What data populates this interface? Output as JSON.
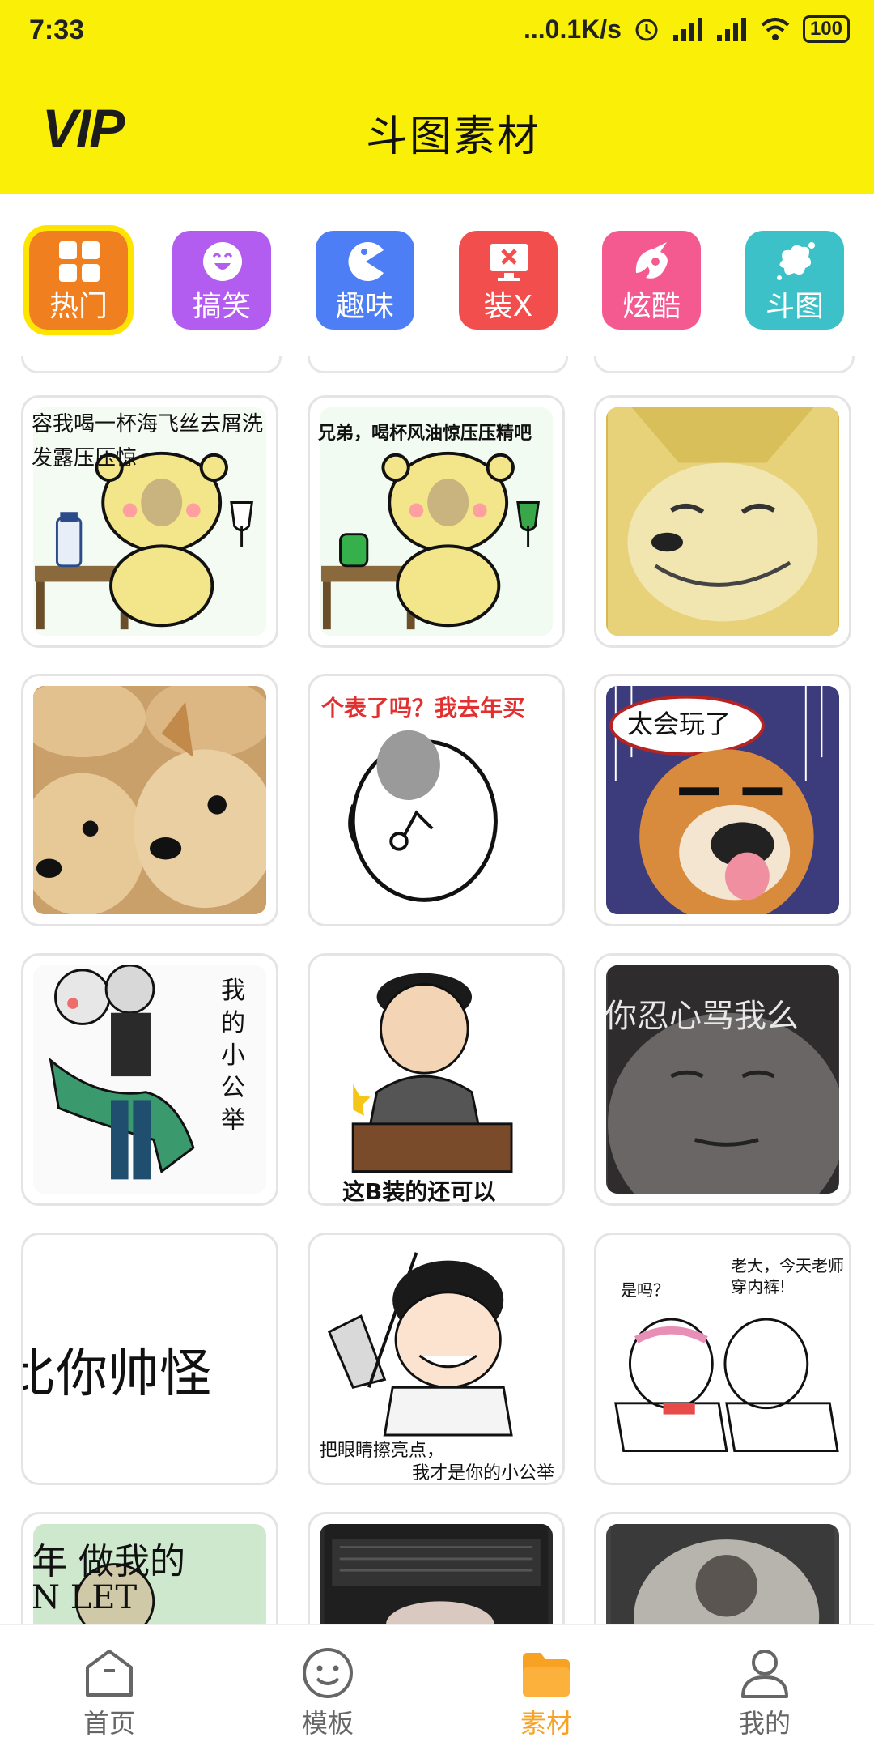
{
  "status": {
    "time": "7:33",
    "network": "...0.1K/s",
    "battery": "100"
  },
  "header": {
    "vip_logo": "VIP",
    "title": "斗图素材"
  },
  "categories": [
    {
      "label": "热门",
      "icon": "grid-icon",
      "color": "#f07f1f",
      "active": true
    },
    {
      "label": "搞笑",
      "icon": "laugh-icon",
      "color": "#b35cf0"
    },
    {
      "label": "趣味",
      "icon": "pacman-icon",
      "color": "#4d7ef5"
    },
    {
      "label": "装X",
      "icon": "screen-x-icon",
      "color": "#f24e4e"
    },
    {
      "label": "炫酷",
      "icon": "flame-icon",
      "color": "#f45a8f"
    },
    {
      "label": "斗图",
      "icon": "splash-icon",
      "color": "#3cc1c8"
    }
  ],
  "memes": [
    {
      "caption": "容我喝一杯海飞丝去屑洗发露压压惊",
      "line1": "容我喝一杯海飞丝去屑洗",
      "line2": "发露压压惊"
    },
    {
      "caption": "兄弟，喝杯风油惊压压精吧",
      "line1": "兄弟，喝杯风油惊压压精吧"
    },
    {
      "caption": ""
    },
    {
      "caption": ""
    },
    {
      "caption": "个表了吗？我去年买",
      "line1": "个表了吗？我去年买"
    },
    {
      "caption": "太会玩了",
      "line1": "太会玩了"
    },
    {
      "caption": "我的小公举",
      "vertical": [
        "我",
        "的",
        "小",
        "公",
        "举"
      ]
    },
    {
      "caption": "这B装的还可以",
      "line1": "这B装的还可以"
    },
    {
      "caption": "你忍心骂我么",
      "line1": "你忍心骂我么"
    },
    {
      "caption": "比你帅怪",
      "line1": "比你帅怪"
    },
    {
      "caption": "把眼睛擦亮点，我才是你的小公举",
      "line1": "把眼睛擦亮点，",
      "line2": "我才是你的小公举"
    },
    {
      "caption": "老大，今天老师穿内裤！是吗？",
      "line1": "老大，今天老师",
      "line2": "穿内裤!",
      "line3": "是吗？"
    },
    {
      "caption": "年 做我的 N LET",
      "line1": "年   做我的",
      "line2": "N    LET"
    },
    {
      "caption": ""
    },
    {
      "caption": ""
    }
  ],
  "bottom_nav": [
    {
      "label": "首页",
      "icon": "home-icon"
    },
    {
      "label": "模板",
      "icon": "smiley-icon"
    },
    {
      "label": "素材",
      "icon": "folder-icon",
      "active": true
    },
    {
      "label": "我的",
      "icon": "person-icon"
    }
  ],
  "colors": {
    "header_bg": "#faef06",
    "accent": "#f7a223",
    "active_outline": "#ffe400"
  }
}
